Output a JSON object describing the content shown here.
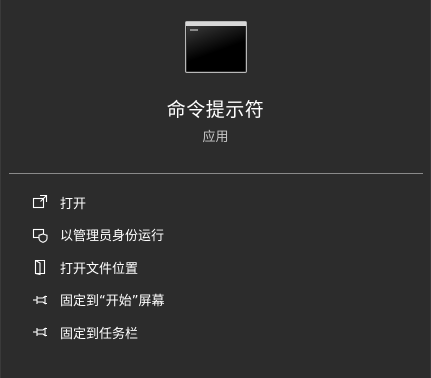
{
  "app": {
    "title": "命令提示符",
    "type": "应用",
    "icon": "command-prompt-icon"
  },
  "menu": [
    {
      "label": "打开",
      "icon": "open-icon"
    },
    {
      "label": "以管理员身份运行",
      "icon": "shield-icon"
    },
    {
      "label": "打开文件位置",
      "icon": "folder-icon"
    },
    {
      "label": "固定到“开始”屏幕",
      "icon": "pin-icon"
    },
    {
      "label": "固定到任务栏",
      "icon": "pin-icon"
    }
  ],
  "colors": {
    "background": "#2c2c2c",
    "text": "#ffffff",
    "subtext": "#c8c8c8",
    "divider": "#8a8a8a"
  }
}
